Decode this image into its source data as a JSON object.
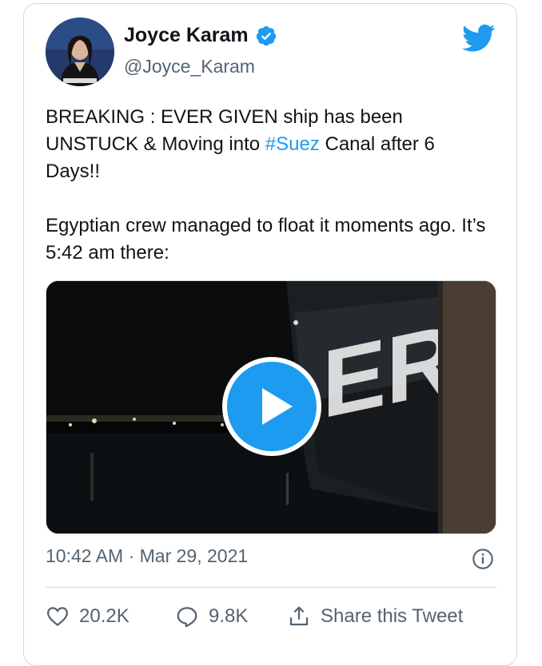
{
  "tweet": {
    "author_name": "Joyce Karam",
    "handle": "@Joyce_Karam",
    "text_part1": "BREAKING : EVER GIVEN ship has been UNSTUCK & Moving into ",
    "hashtag": "#Suez",
    "text_part2": " Canal after 6 Days!!",
    "text_para2": "Egyptian crew managed to float it moments ago. It’s 5:42 am there:",
    "timestamp": "10:42 AM · Mar 29, 2021",
    "media_ship_lettering": "ERG"
  },
  "actions": {
    "like_count": "20.2K",
    "reply_count": "9.8K",
    "share_label": "Share this Tweet"
  },
  "icons": {
    "verified": "verified-badge-icon",
    "logo": "twitter-bird-icon",
    "play": "play-icon",
    "info": "info-icon",
    "like": "heart-icon",
    "reply": "speech-bubble-icon",
    "share": "share-upload-icon"
  },
  "colors": {
    "accent": "#1d9bf0",
    "text_primary": "#0f1419",
    "text_secondary": "#536471",
    "border": "#cfd9de"
  }
}
